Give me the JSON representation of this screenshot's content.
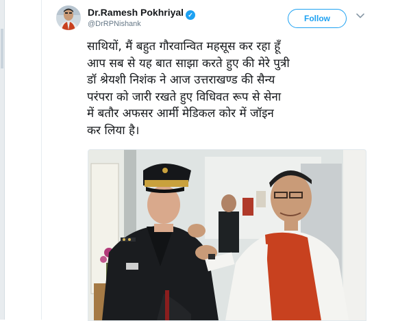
{
  "tweet": {
    "display_name": "Dr.Ramesh Pokhriyal",
    "handle": "@DrRPNishank",
    "verified_icon": "verified-badge-icon",
    "follow_label": "Follow",
    "menu_icon": "chevron-down-icon",
    "text_lines": [
      "साथियों, मैं बहुत गौरवान्वित महसूस कर रहा हूँ",
      "आप सब से यह बात साझा करते हुए की मेरे पुत्री",
      "डॉ श्रेयशी निशंक ने आज उत्तराखण्ड की सैन्य",
      "परंपरा को जारी रखते हुए विधिवत रूप से सेना",
      "में बतौर अफसर आर्मी मेडिकल कोर में जॉइन",
      "कर लिया है।"
    ]
  },
  "colors": {
    "accent": "#1da1f2",
    "text": "#14171a",
    "secondary_text": "#657786",
    "uniform": "#1a1c1f",
    "jacket": "#c8411f"
  }
}
